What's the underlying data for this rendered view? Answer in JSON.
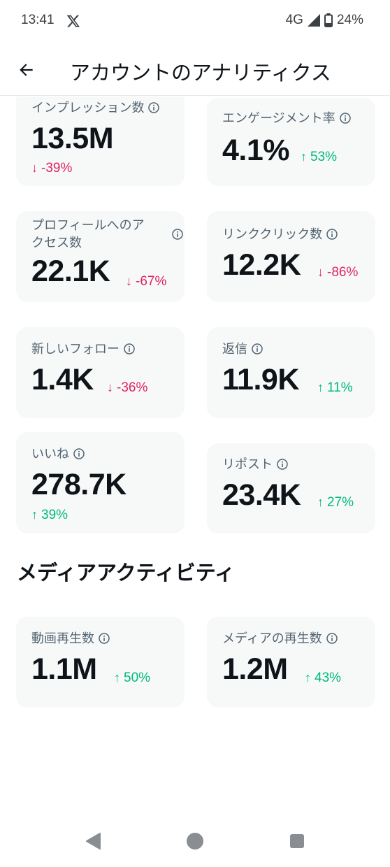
{
  "status_bar": {
    "time": "13:41",
    "network": "4G",
    "battery": "24%",
    "icons": [
      "x-logo-icon",
      "signal-icon",
      "battery-icon"
    ]
  },
  "app_bar": {
    "title": "アカウントのアナリティクス",
    "back_icon": "arrow-left-icon"
  },
  "metrics": [
    {
      "label": "インプレッション数",
      "value": "13.5M",
      "delta": "-39%",
      "direction": "down"
    },
    {
      "label": "エンゲージメント率",
      "value": "4.1%",
      "delta": "53%",
      "direction": "up"
    },
    {
      "label_line1": "プロフィールへのア",
      "label_line2": "クセス数",
      "value": "22.1K",
      "delta": "-67%",
      "direction": "down"
    },
    {
      "label": "リンククリック数",
      "value": "12.2K",
      "delta": "-86%",
      "direction": "down"
    },
    {
      "label": "新しいフォロー",
      "value": "1.4K",
      "delta": "-36%",
      "direction": "down"
    },
    {
      "label": "返信",
      "value": "11.9K",
      "delta": "11%",
      "direction": "up"
    },
    {
      "label": "いいね",
      "value": "278.7K",
      "delta": "39%",
      "direction": "up"
    },
    {
      "label": "リポスト",
      "value": "23.4K",
      "delta": "27%",
      "direction": "up"
    }
  ],
  "media_section": {
    "title": "メディアアクティビティ",
    "metrics": [
      {
        "label": "動画再生数",
        "value": "1.1M",
        "delta": "50%",
        "direction": "up"
      },
      {
        "label": "メディアの再生数",
        "value": "1.2M",
        "delta": "43%",
        "direction": "up"
      }
    ]
  },
  "colors": {
    "down": "#e0245e",
    "up": "#00ba7c",
    "card_bg": "#f7f9f9",
    "secondary_text": "#536471"
  },
  "nav_bar": {
    "icons": [
      "nav-back-icon",
      "nav-home-icon",
      "nav-recents-icon"
    ]
  }
}
